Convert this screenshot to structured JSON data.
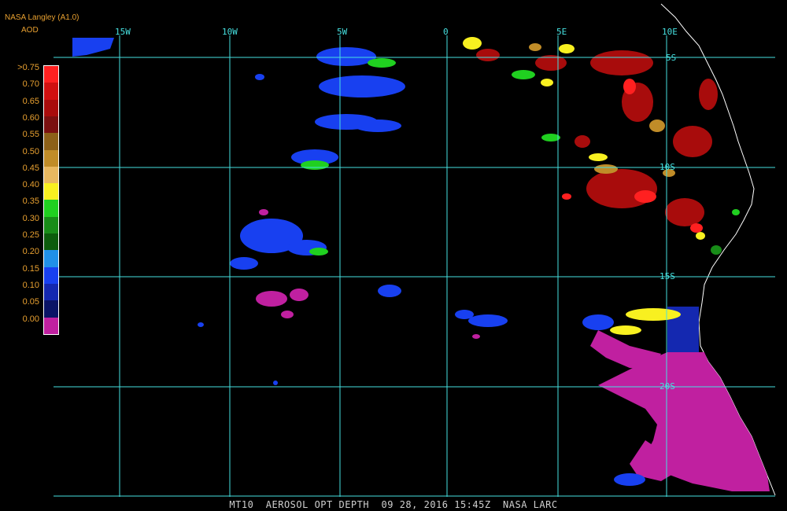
{
  "header": {
    "source": "NASA Langley (A1.0)",
    "product": "AOD"
  },
  "legend": [
    {
      "label": ">0.75",
      "color": "#ff2020"
    },
    {
      "label": "0.70",
      "color": "#d01010"
    },
    {
      "label": "0.65",
      "color": "#a80c0c"
    },
    {
      "label": "0.60",
      "color": "#7a1010"
    },
    {
      "label": "0.55",
      "color": "#8c6018"
    },
    {
      "label": "0.50",
      "color": "#c08c28"
    },
    {
      "label": "0.45",
      "color": "#e8b860"
    },
    {
      "label": "0.40",
      "color": "#f8f020"
    },
    {
      "label": "0.35",
      "color": "#20d020"
    },
    {
      "label": "0.30",
      "color": "#188c18"
    },
    {
      "label": "0.25",
      "color": "#0c5c0c"
    },
    {
      "label": "0.20",
      "color": "#2090e8"
    },
    {
      "label": "0.15",
      "color": "#1840f0"
    },
    {
      "label": "0.10",
      "color": "#1428b0"
    },
    {
      "label": "0.05",
      "color": "#0a1466"
    },
    {
      "label": "0.00",
      "color": "#c020a0"
    }
  ],
  "grid": {
    "longitude_labels": [
      "15W",
      "10W",
      "5W",
      "0",
      "5E",
      "10E"
    ],
    "latitude_labels": [
      "5S",
      "10S",
      "15S",
      "20S"
    ],
    "line_color": "#46e0e0"
  },
  "footer": "MT10  AEROSOL OPT DEPTH  09 28, 2016 15:45Z  NASA LARC"
}
